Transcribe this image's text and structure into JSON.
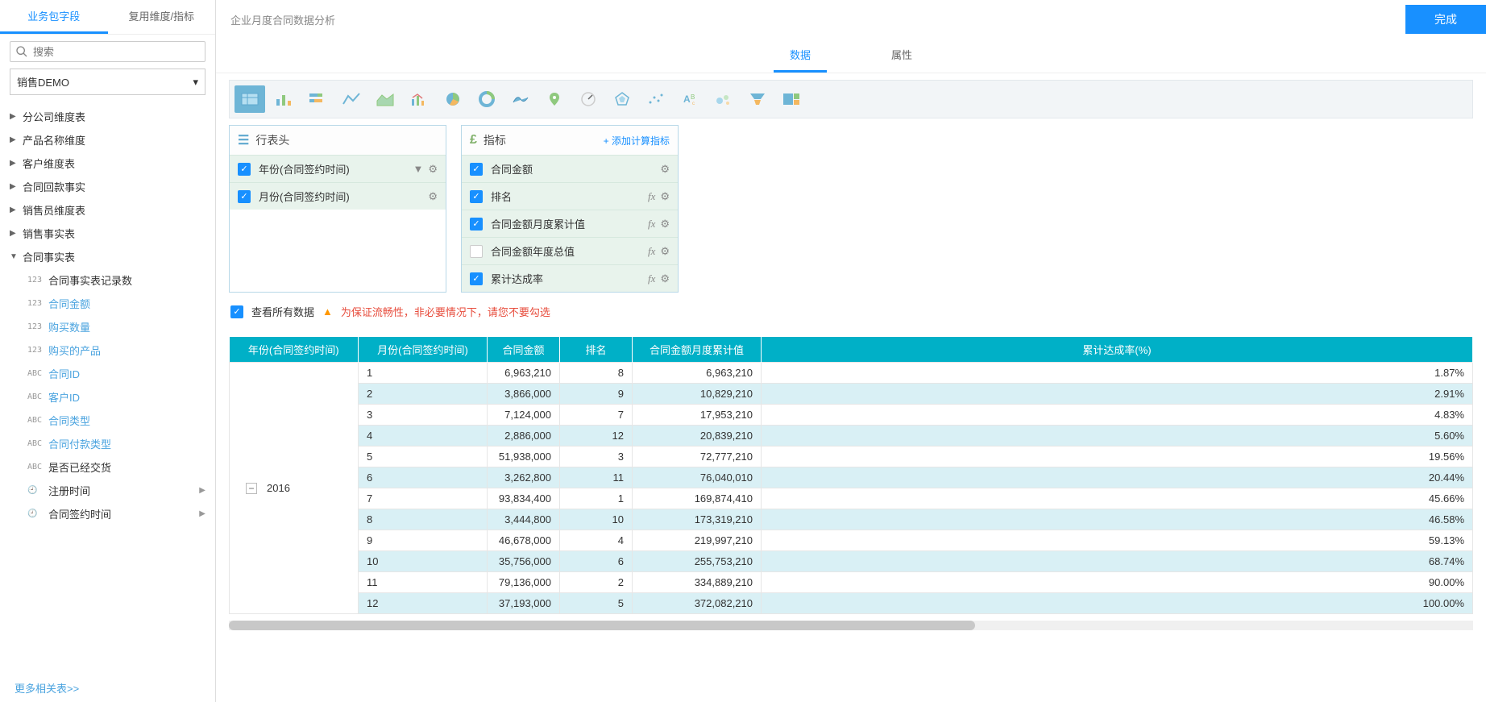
{
  "sidebar": {
    "tabs": [
      "业务包字段",
      "复用维度/指标"
    ],
    "search_placeholder": "搜索",
    "select_value": "销售DEMO",
    "nodes": [
      {
        "label": "分公司维度表",
        "expanded": false
      },
      {
        "label": "产品名称维度",
        "expanded": false
      },
      {
        "label": "客户维度表",
        "expanded": false
      },
      {
        "label": "合同回款事实",
        "expanded": false
      },
      {
        "label": "销售员维度表",
        "expanded": false
      },
      {
        "label": "销售事实表",
        "expanded": false
      },
      {
        "label": "合同事实表",
        "expanded": true,
        "children": [
          {
            "type": "123",
            "label": "合同事实表记录数",
            "plain": true
          },
          {
            "type": "123",
            "label": "合同金额"
          },
          {
            "type": "123",
            "label": "购买数量"
          },
          {
            "type": "123",
            "label": "购买的产品"
          },
          {
            "type": "ABC",
            "label": "合同ID"
          },
          {
            "type": "ABC",
            "label": "客户ID"
          },
          {
            "type": "ABC",
            "label": "合同类型"
          },
          {
            "type": "ABC",
            "label": "合同付款类型"
          },
          {
            "type": "ABC",
            "label": "是否已经交货",
            "plain": true
          },
          {
            "type": "clock",
            "label": "注册时间",
            "plain": true,
            "arrow": true
          },
          {
            "type": "clock",
            "label": "合同签约时间",
            "plain": true,
            "arrow": true
          }
        ]
      }
    ],
    "more": "更多相关表>>"
  },
  "header": {
    "title": "企业月度合同数据分析",
    "done": "完成"
  },
  "center_tabs": [
    "数据",
    "属性"
  ],
  "chart_types": [
    "table",
    "bar",
    "stacked-bar",
    "line",
    "area",
    "combo",
    "pie",
    "donut",
    "map",
    "point-map",
    "gauge",
    "radar",
    "scatter",
    "word",
    "bubble",
    "funnel",
    "treemap"
  ],
  "row_panel": {
    "title": "行表头",
    "items": [
      {
        "checked": true,
        "label": "年份(合同签约时间)",
        "filter": true,
        "gear": true
      },
      {
        "checked": true,
        "label": "月份(合同签约时间)",
        "gear": true
      }
    ]
  },
  "metric_panel": {
    "title": "指标",
    "add_label": "+ 添加计算指标",
    "items": [
      {
        "checked": true,
        "label": "合同金额",
        "gear": true
      },
      {
        "checked": true,
        "label": "排名",
        "fx": true,
        "gear": true
      },
      {
        "checked": true,
        "label": "合同金额月度累计值",
        "fx": true,
        "gear": true
      },
      {
        "checked": false,
        "label": "合同金额年度总值",
        "fx": true,
        "gear": true
      },
      {
        "checked": true,
        "label": "累计达成率",
        "fx": true,
        "gear": true
      }
    ]
  },
  "view_all": {
    "label": "查看所有数据",
    "warning": "为保证流畅性，非必要情况下，请您不要勾选"
  },
  "table": {
    "columns": [
      "年份(合同签约时间)",
      "月份(合同签约时间)",
      "合同金额",
      "排名",
      "合同金额月度累计值",
      "累计达成率(%)"
    ],
    "year": "2016",
    "rows": [
      {
        "month": "1",
        "amount": "6,963,210",
        "rank": "8",
        "cum": "6,963,210",
        "rate": "1.87%"
      },
      {
        "month": "2",
        "amount": "3,866,000",
        "rank": "9",
        "cum": "10,829,210",
        "rate": "2.91%"
      },
      {
        "month": "3",
        "amount": "7,124,000",
        "rank": "7",
        "cum": "17,953,210",
        "rate": "4.83%"
      },
      {
        "month": "4",
        "amount": "2,886,000",
        "rank": "12",
        "cum": "20,839,210",
        "rate": "5.60%"
      },
      {
        "month": "5",
        "amount": "51,938,000",
        "rank": "3",
        "cum": "72,777,210",
        "rate": "19.56%"
      },
      {
        "month": "6",
        "amount": "3,262,800",
        "rank": "11",
        "cum": "76,040,010",
        "rate": "20.44%"
      },
      {
        "month": "7",
        "amount": "93,834,400",
        "rank": "1",
        "cum": "169,874,410",
        "rate": "45.66%"
      },
      {
        "month": "8",
        "amount": "3,444,800",
        "rank": "10",
        "cum": "173,319,210",
        "rate": "46.58%"
      },
      {
        "month": "9",
        "amount": "46,678,000",
        "rank": "4",
        "cum": "219,997,210",
        "rate": "59.13%"
      },
      {
        "month": "10",
        "amount": "35,756,000",
        "rank": "6",
        "cum": "255,753,210",
        "rate": "68.74%"
      },
      {
        "month": "11",
        "amount": "79,136,000",
        "rank": "2",
        "cum": "334,889,210",
        "rate": "90.00%"
      },
      {
        "month": "12",
        "amount": "37,193,000",
        "rank": "5",
        "cum": "372,082,210",
        "rate": "100.00%"
      }
    ]
  },
  "chart_data": {
    "type": "table",
    "title": "企业月度合同数据分析",
    "columns": [
      "年份(合同签约时间)",
      "月份(合同签约时间)",
      "合同金额",
      "排名",
      "合同金额月度累计值",
      "累计达成率(%)"
    ],
    "year": 2016,
    "series": [
      {
        "name": "合同金额",
        "values": [
          6963210,
          3866000,
          7124000,
          2886000,
          51938000,
          3262800,
          93834400,
          3444800,
          46678000,
          35756000,
          79136000,
          37193000
        ]
      },
      {
        "name": "排名",
        "values": [
          8,
          9,
          7,
          12,
          3,
          11,
          1,
          10,
          4,
          6,
          2,
          5
        ]
      },
      {
        "name": "合同金额月度累计值",
        "values": [
          6963210,
          10829210,
          17953210,
          20839210,
          72777210,
          76040010,
          169874410,
          173319210,
          219997210,
          255753210,
          334889210,
          372082210
        ]
      },
      {
        "name": "累计达成率(%)",
        "values": [
          1.87,
          2.91,
          4.83,
          5.6,
          19.56,
          20.44,
          45.66,
          46.58,
          59.13,
          68.74,
          90.0,
          100.0
        ]
      }
    ],
    "categories": [
      1,
      2,
      3,
      4,
      5,
      6,
      7,
      8,
      9,
      10,
      11,
      12
    ]
  }
}
